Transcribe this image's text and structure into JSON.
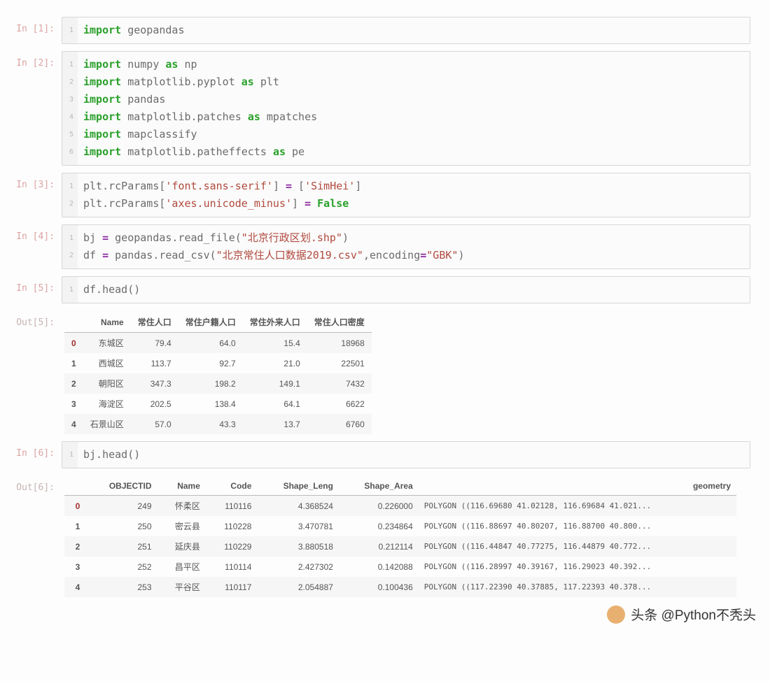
{
  "cells": [
    {
      "prompt": "In [1]:",
      "type": "code",
      "lines": [
        [
          {
            "t": "import",
            "c": "kw"
          },
          {
            "t": " geopandas",
            "c": "txt"
          }
        ]
      ]
    },
    {
      "prompt": "In [2]:",
      "type": "code",
      "lines": [
        [
          {
            "t": "import",
            "c": "kw"
          },
          {
            "t": " numpy ",
            "c": "txt"
          },
          {
            "t": "as",
            "c": "kw"
          },
          {
            "t": " np",
            "c": "txt"
          }
        ],
        [
          {
            "t": "import",
            "c": "kw"
          },
          {
            "t": " matplotlib.pyplot ",
            "c": "txt"
          },
          {
            "t": "as",
            "c": "kw"
          },
          {
            "t": " plt",
            "c": "txt"
          }
        ],
        [
          {
            "t": "import",
            "c": "kw"
          },
          {
            "t": " pandas",
            "c": "txt"
          }
        ],
        [
          {
            "t": "import",
            "c": "kw"
          },
          {
            "t": " matplotlib.patches ",
            "c": "txt"
          },
          {
            "t": "as",
            "c": "kw"
          },
          {
            "t": " mpatches",
            "c": "txt"
          }
        ],
        [
          {
            "t": "import",
            "c": "kw"
          },
          {
            "t": " mapclassify",
            "c": "txt"
          }
        ],
        [
          {
            "t": "import",
            "c": "kw"
          },
          {
            "t": " matplotlib.patheffects ",
            "c": "txt"
          },
          {
            "t": "as",
            "c": "kw"
          },
          {
            "t": " pe",
            "c": "txt"
          }
        ]
      ]
    },
    {
      "prompt": "In [3]:",
      "type": "code",
      "lines": [
        [
          {
            "t": "plt.rcParams[",
            "c": "txt"
          },
          {
            "t": "'font.sans-serif'",
            "c": "str"
          },
          {
            "t": "] ",
            "c": "txt"
          },
          {
            "t": "=",
            "c": "op"
          },
          {
            "t": " [",
            "c": "txt"
          },
          {
            "t": "'SimHei'",
            "c": "str"
          },
          {
            "t": "]",
            "c": "txt"
          }
        ],
        [
          {
            "t": "plt.rcParams[",
            "c": "txt"
          },
          {
            "t": "'axes.unicode_minus'",
            "c": "str"
          },
          {
            "t": "] ",
            "c": "txt"
          },
          {
            "t": "=",
            "c": "op"
          },
          {
            "t": " ",
            "c": "txt"
          },
          {
            "t": "False",
            "c": "kw2"
          }
        ]
      ]
    },
    {
      "prompt": "In [4]:",
      "type": "code",
      "lines": [
        [
          {
            "t": "bj ",
            "c": "txt"
          },
          {
            "t": "=",
            "c": "op"
          },
          {
            "t": " geopandas.read_file(",
            "c": "txt"
          },
          {
            "t": "\"北京行政区划.shp\"",
            "c": "str"
          },
          {
            "t": ")",
            "c": "txt"
          }
        ],
        [
          {
            "t": "df ",
            "c": "txt"
          },
          {
            "t": "=",
            "c": "op"
          },
          {
            "t": " pandas.read_csv(",
            "c": "txt"
          },
          {
            "t": "\"北京常住人口数据2019.csv\"",
            "c": "str"
          },
          {
            "t": ",encoding",
            "c": "txt"
          },
          {
            "t": "=",
            "c": "op"
          },
          {
            "t": "\"GBK\"",
            "c": "str"
          },
          {
            "t": ")",
            "c": "txt"
          }
        ]
      ]
    },
    {
      "prompt": "In [5]:",
      "type": "code",
      "lines": [
        [
          {
            "t": "df.head()",
            "c": "txt"
          }
        ]
      ]
    },
    {
      "prompt": "Out[5]:",
      "type": "table",
      "table": {
        "columns": [
          "Name",
          "常住人口",
          "常住户籍人口",
          "常住外来人口",
          "常住人口密度"
        ],
        "index": [
          "0",
          "1",
          "2",
          "3",
          "4"
        ],
        "rows": [
          [
            "东城区",
            "79.4",
            "64.0",
            "15.4",
            "18968"
          ],
          [
            "西城区",
            "113.7",
            "92.7",
            "21.0",
            "22501"
          ],
          [
            "朝阳区",
            "347.3",
            "198.2",
            "149.1",
            "7432"
          ],
          [
            "海淀区",
            "202.5",
            "138.4",
            "64.1",
            "6622"
          ],
          [
            "石景山区",
            "57.0",
            "43.3",
            "13.7",
            "6760"
          ]
        ]
      }
    },
    {
      "prompt": "In [6]:",
      "type": "code",
      "lines": [
        [
          {
            "t": "bj.head()",
            "c": "txt"
          }
        ]
      ]
    },
    {
      "prompt": "Out[6]:",
      "type": "table2",
      "table": {
        "columns": [
          "OBJECTID",
          "Name",
          "Code",
          "Shape_Leng",
          "Shape_Area",
          "geometry"
        ],
        "index": [
          "0",
          "1",
          "2",
          "3",
          "4"
        ],
        "rows": [
          [
            "249",
            "怀柔区",
            "110116",
            "4.368524",
            "0.226000",
            "POLYGON ((116.69680 41.02128, 116.69684 41.021..."
          ],
          [
            "250",
            "密云县",
            "110228",
            "3.470781",
            "0.234864",
            "POLYGON ((116.88697 40.80207, 116.88700 40.800..."
          ],
          [
            "251",
            "延庆县",
            "110229",
            "3.880518",
            "0.212114",
            "POLYGON ((116.44847 40.77275, 116.44879 40.772..."
          ],
          [
            "252",
            "昌平区",
            "110114",
            "2.427302",
            "0.142088",
            "POLYGON ((116.28997 40.39167, 116.29023 40.392..."
          ],
          [
            "253",
            "平谷区",
            "110117",
            "2.054887",
            "0.100436",
            "POLYGON ((117.22390 40.37885, 117.22393 40.378..."
          ]
        ]
      }
    }
  ],
  "watermark": "头条 @Python不秃头"
}
